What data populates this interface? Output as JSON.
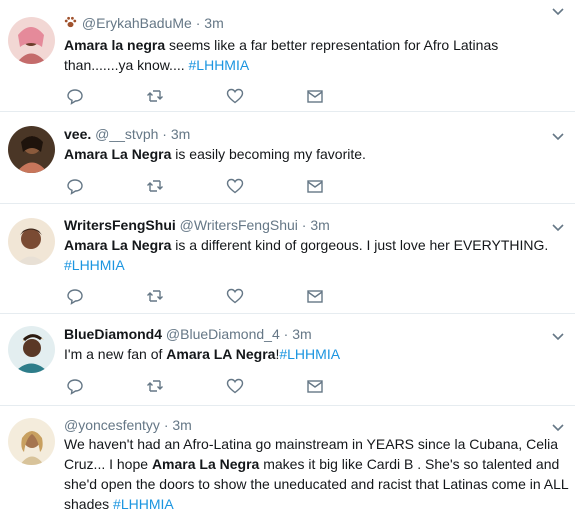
{
  "tweets": [
    {
      "name": "",
      "handle": "@ErykahBaduMe",
      "name_emoji": "paw-prints-icon",
      "dot": "·",
      "time": "3m",
      "parts": [
        {
          "t": "Amara la negra",
          "b": true
        },
        {
          "t": " seems like a far better representation for Afro Latinas than.......ya know.... "
        },
        {
          "t": "#LHHMIA",
          "h": true
        }
      ],
      "avatar_color": "#c46b6b"
    },
    {
      "name": "vee.",
      "handle": "@__stvph",
      "dot": "·",
      "time": "3m",
      "parts": [
        {
          "t": "Amara La Negra",
          "b": true
        },
        {
          "t": " is easily becoming my favorite."
        }
      ],
      "avatar_color": "#3d2a1e"
    },
    {
      "name": "WritersFengShui",
      "handle": "@WritersFengShui",
      "dot": "·",
      "time": "3m",
      "parts": [
        {
          "t": "Amara La Negra",
          "b": true
        },
        {
          "t": " is a different kind of gorgeous. I just love her EVERYTHING. "
        },
        {
          "t": "#LHHMIA",
          "h": true
        }
      ],
      "avatar_color": "#e9d8c2"
    },
    {
      "name": "BlueDiamond4",
      "handle": "@BlueDiamond_4",
      "dot": "·",
      "time": "3m",
      "parts": [
        {
          "t": "I'm a new fan of "
        },
        {
          "t": "Amara LA Negra",
          "b": true
        },
        {
          "t": "!"
        },
        {
          "t": "#LHHMIA",
          "h": true
        }
      ],
      "avatar_color": "#2e7d8a"
    },
    {
      "name": "",
      "handle": "@yoncesfentyy",
      "dot": "·",
      "time": "3m",
      "parts": [
        {
          "t": "We haven't had an Afro-Latina go mainstream in YEARS since la Cubana, Celia Cruz... I hope "
        },
        {
          "t": "Amara La Negra",
          "b": true
        },
        {
          "t": " makes it big like Cardi B . She's so talented and she'd open the doors to show the uneducated and racist that Latinas come in ALL shades  "
        },
        {
          "t": "#LHHMIA",
          "h": true
        }
      ],
      "avatar_color": "#d8c39a"
    }
  ],
  "icons": {
    "reply": "reply-icon",
    "retweet": "retweet-icon",
    "like": "heart-icon",
    "message": "envelope-icon",
    "menu": "chevron-down-icon"
  },
  "colors": {
    "hashtag": "#1b95e0",
    "muted": "#657786",
    "icon": "#657786",
    "divider": "#e6ecf0"
  }
}
